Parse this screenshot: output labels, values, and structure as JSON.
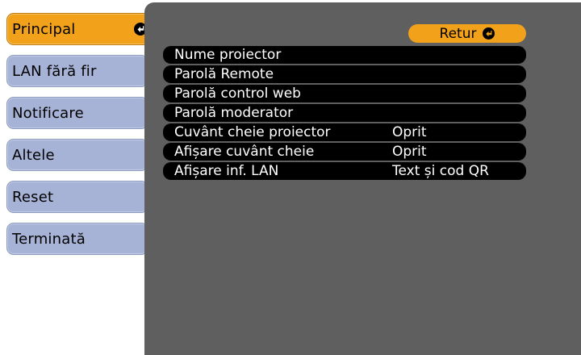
{
  "sidebar": {
    "items": [
      {
        "label": "Principal",
        "active": true
      },
      {
        "label": "LAN fără fir",
        "active": false
      },
      {
        "label": "Notificare",
        "active": false
      },
      {
        "label": "Altele",
        "active": false
      },
      {
        "label": "Reset",
        "active": false
      },
      {
        "label": "Terminată",
        "active": false
      }
    ]
  },
  "panel": {
    "return_label": "Retur",
    "settings": [
      {
        "label": "Nume proiector",
        "value": ""
      },
      {
        "label": "Parolă Remote",
        "value": ""
      },
      {
        "label": "Parolă control web",
        "value": ""
      },
      {
        "label": "Parolă moderator",
        "value": ""
      },
      {
        "label": "Cuvânt cheie proiector",
        "value": "Oprit"
      },
      {
        "label": "Afișare cuvânt cheie",
        "value": "Oprit"
      },
      {
        "label": "Afișare inf. LAN",
        "value": "Text și cod QR"
      }
    ]
  },
  "colors": {
    "accent": "#f2a21a",
    "sidebar_item": "#a7b3d6",
    "panel_bg": "#5f5f5f",
    "row_bg": "#000000"
  },
  "icons": {
    "enter": "enter-return-icon"
  }
}
